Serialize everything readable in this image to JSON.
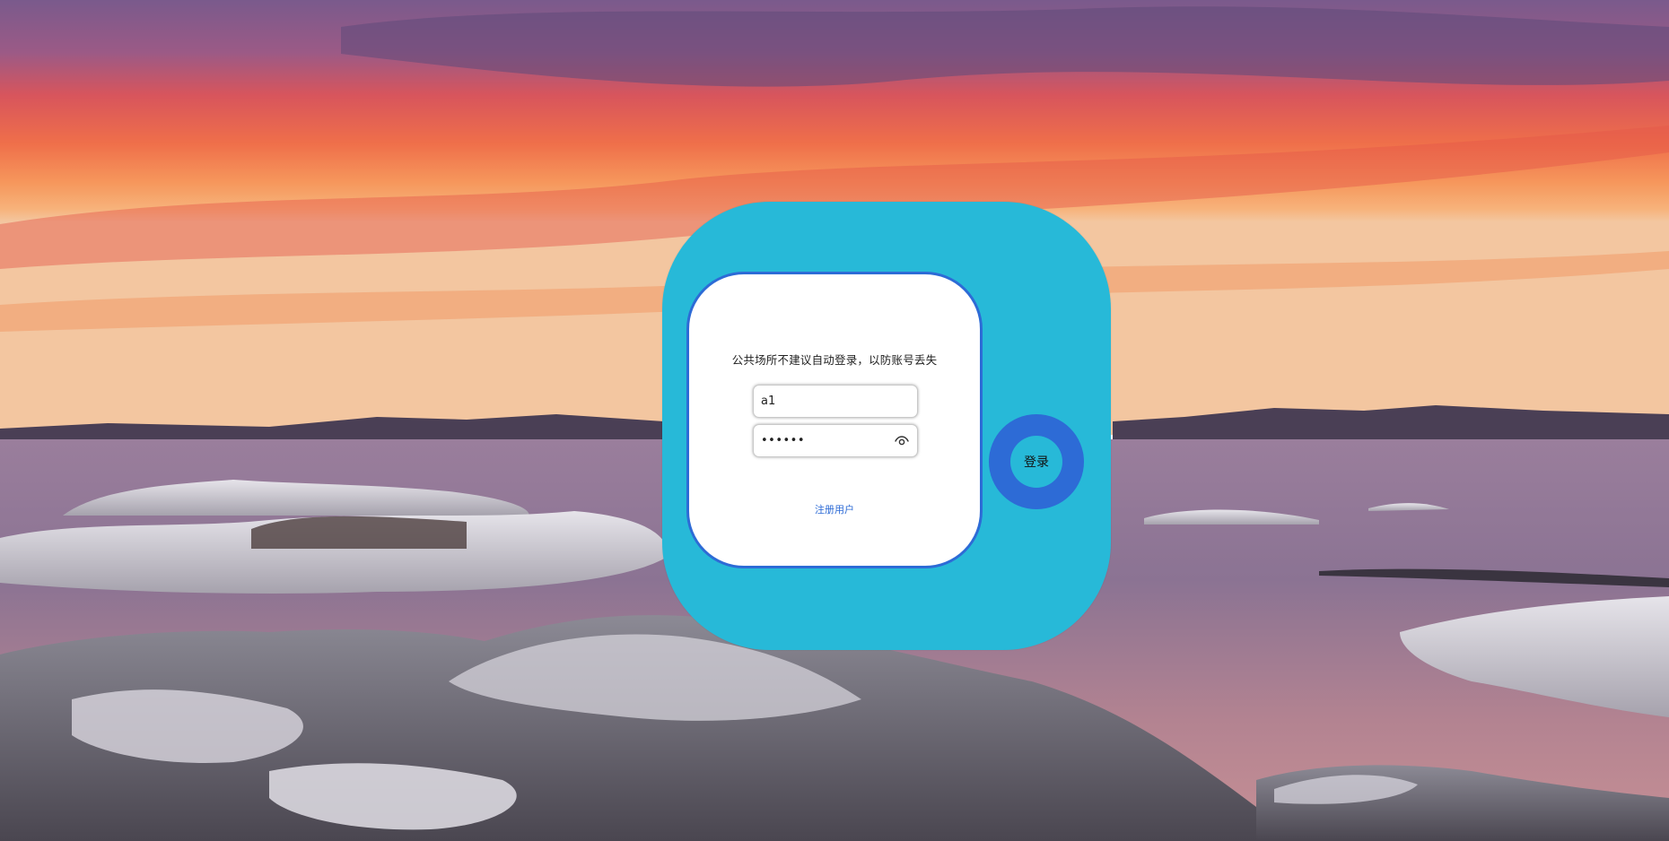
{
  "login": {
    "notice": "公共场所不建议自动登录，以防账号丢失",
    "username": {
      "value": "a1"
    },
    "password": {
      "value": "••••••",
      "masked": true
    },
    "eye_icon": "eye-icon",
    "register_label": "注册用户",
    "submit_label": "登录"
  },
  "colors": {
    "outer_panel": "#27b9d8",
    "card_border": "#2d6bd6",
    "login_ring": "#2d6bd6",
    "link": "#2d6bd6"
  }
}
